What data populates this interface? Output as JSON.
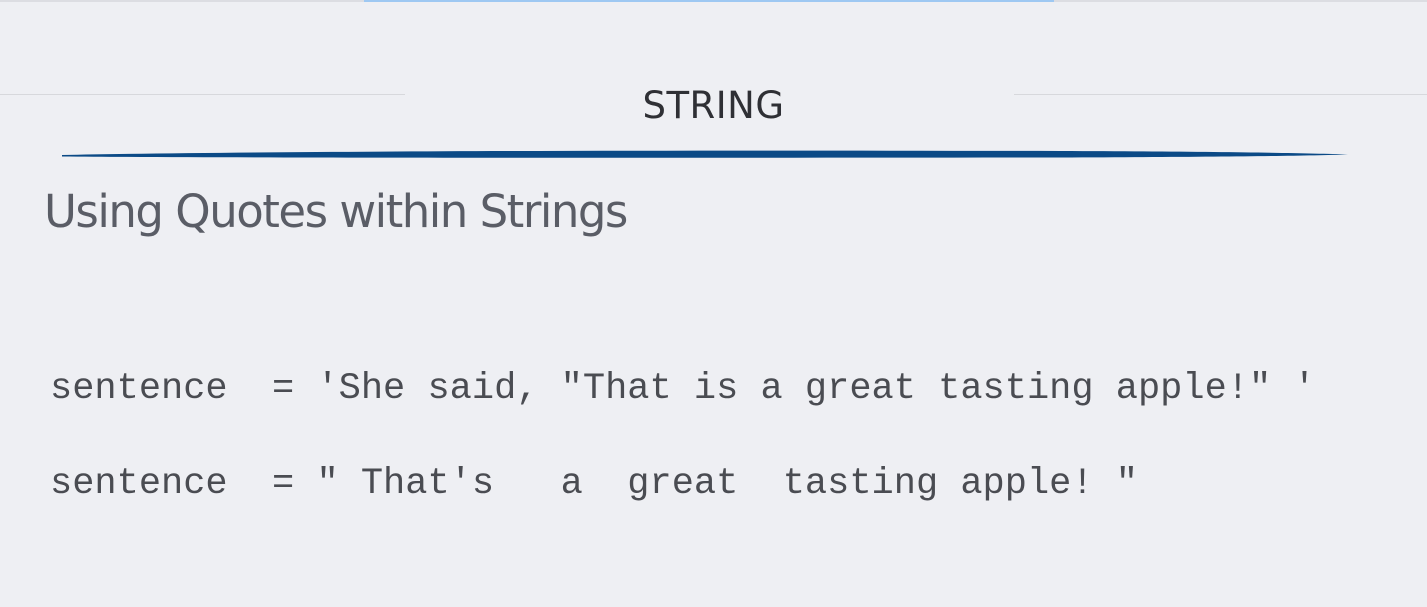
{
  "slide": {
    "section_title": "STRING",
    "heading": "Using Quotes within Strings",
    "code_lines": [
      "sentence  = 'She said, \"That is a great tasting apple!\" '",
      "sentence  = \" That's   a  great  tasting apple! \""
    ]
  },
  "colors": {
    "background": "#eeeff3",
    "accent_stroke": "#0b4a86",
    "top_accent": "#9ec8f2"
  }
}
